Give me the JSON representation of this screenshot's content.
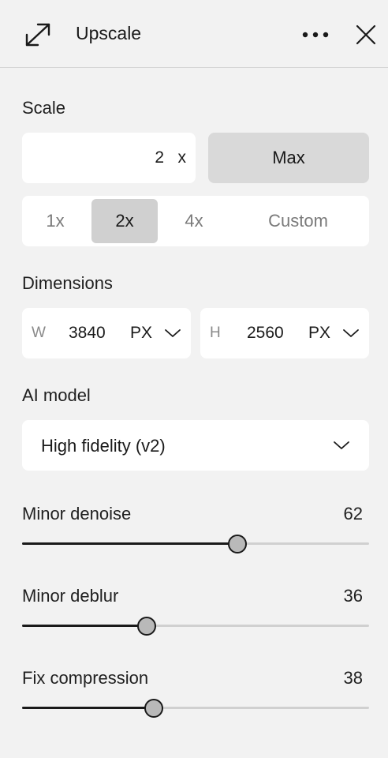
{
  "header": {
    "title": "Upscale",
    "expand_icon": "expand-arrows-icon",
    "more_icon": "more-horizontal-icon",
    "close_icon": "close-icon"
  },
  "scale": {
    "label": "Scale",
    "value": "2",
    "unit": "x",
    "max_label": "Max",
    "options": [
      "1x",
      "2x",
      "4x",
      "Custom"
    ],
    "selected": "2x"
  },
  "dimensions": {
    "label": "Dimensions",
    "width": {
      "letter": "W",
      "value": "3840",
      "unit": "PX"
    },
    "height": {
      "letter": "H",
      "value": "2560",
      "unit": "PX"
    }
  },
  "model": {
    "label": "AI model",
    "selected": "High fidelity (v2)"
  },
  "sliders": [
    {
      "name": "Minor denoise",
      "value": "62",
      "level": 0.62
    },
    {
      "name": "Minor deblur",
      "value": "36",
      "level": 0.36
    },
    {
      "name": "Fix compression",
      "value": "38",
      "level": 0.38
    }
  ],
  "colors": {
    "background": "#f2f2f2",
    "field": "#ffffff",
    "active_segment": "#d0d0d0",
    "max_button": "#d9d9d9",
    "slider_fill": "#1a1a1a",
    "slider_track": "#d0d0d0"
  }
}
